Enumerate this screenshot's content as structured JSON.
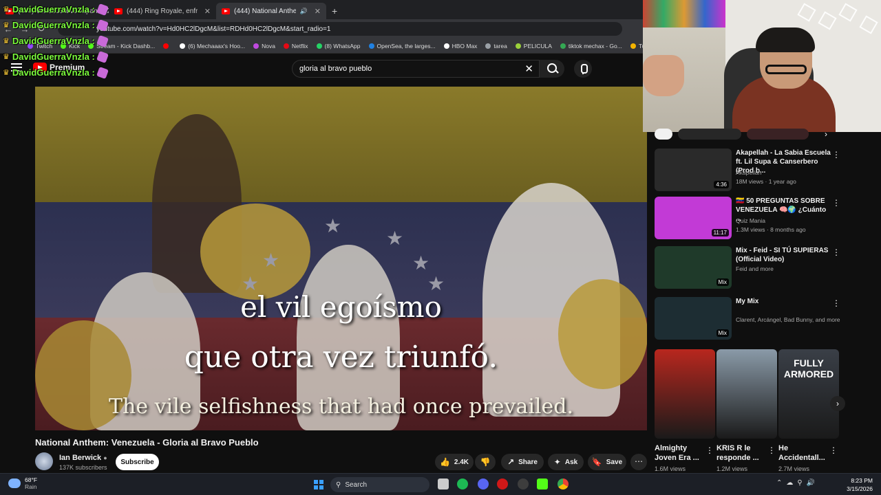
{
  "browser": {
    "tabs": [
      {
        "label": "(444) Venezuela vs Japan 2026",
        "active": false
      },
      {
        "label": "(444) Ring Royale, enfrentamiento",
        "active": false
      },
      {
        "label": "(444) National Anthem: Venezuela",
        "active": true
      }
    ],
    "new_tab": "+",
    "url": "youtube.com/watch?v=Hd0HC2lDgcM&list=RDHd0HC2lDgcM&start_radio=1",
    "bookmarks": [
      {
        "label": "Twitch",
        "color": "#9146ff"
      },
      {
        "label": "Kick",
        "color": "#53fc18"
      },
      {
        "label": "Stream - Kick Dashb...",
        "color": "#53fc18"
      },
      {
        "label": "",
        "color": "#ff0000"
      },
      {
        "label": "(6) Mechaaax's Hoo...",
        "color": "#ffffff"
      },
      {
        "label": "Nova",
        "color": "#c04ae0"
      },
      {
        "label": "Netflix",
        "color": "#e50914"
      },
      {
        "label": "(8) WhatsApp",
        "color": "#25d366"
      },
      {
        "label": "OpenSea, the larges...",
        "color": "#2081e2"
      },
      {
        "label": "HBO Max",
        "color": "#ffffff"
      },
      {
        "label": "tarea",
        "color": "#9aa0a6"
      },
      {
        "label": "PELICULA",
        "color": "#9bd13a"
      },
      {
        "label": "tiktok mechax - Go...",
        "color": "#34a853"
      },
      {
        "label": "Turn You",
        "color": "#f4b400"
      }
    ]
  },
  "youtube": {
    "logo_label": "Premium",
    "search_value": "gloria al bravo pueblo"
  },
  "chat": {
    "username": "DavidGuerraVnzla :",
    "lines": 5
  },
  "video": {
    "subtitle_line1": "el vil egoísmo",
    "subtitle_line2": "que otra vez triunfó.",
    "subtitle_translation": "The vile selfishness that had once prevailed.",
    "title": "National Anthem: Venezuela - Gloria al Bravo Pueblo",
    "channel": "Ian Berwick",
    "subscribers": "137K subscribers",
    "subscribe_label": "Subscribe",
    "likes": "2.4K",
    "share_label": "Share",
    "ask_label": "Ask",
    "save_label": "Save"
  },
  "recommendations": [
    {
      "title": "Akapellah - La Sabia Escuela ft. Lil Supa & Canserbero (Prod b...",
      "channel": "Akapellah",
      "meta": "18M views · 1 year ago",
      "duration": "4:36",
      "thumb": "#2a2a2a"
    },
    {
      "title": "🇻🇪 50 PREGUNTAS SOBRE VENEZUELA 🧠🌍 ¿Cuánto ...",
      "channel": "Quiz Mania",
      "meta": "1.3M views · 8 months ago",
      "duration": "11:17",
      "thumb": "#c23ad6"
    },
    {
      "title": "Mix - Feid - SI TÚ SUPIERAS (Official Video)",
      "channel": "Feid and more",
      "meta": "",
      "duration": "Mix",
      "thumb": "#1f3a2a"
    },
    {
      "title": "My Mix",
      "channel": "Clarent, Arcángel, Bad Bunny, and more",
      "meta": "",
      "duration": "Mix",
      "thumb": "#1d2d33"
    }
  ],
  "shorts": [
    {
      "title": "Almighty Joven Era ...",
      "views": "1.6M views",
      "color": "#b8271e"
    },
    {
      "title": "KRIS R le responde ...",
      "views": "1.2M views",
      "color": "#8a9aa8"
    },
    {
      "title": "He Accidentall...",
      "views": "2.7M views",
      "color": "#3a3f47"
    }
  ],
  "shorts_thumb_texts": {
    "third": "FULLY ARMORED"
  },
  "taskbar": {
    "temp": "68°F",
    "weather": "Rain",
    "search_label": "Search",
    "time": "8:23 PM",
    "date": "3/15/2026"
  }
}
